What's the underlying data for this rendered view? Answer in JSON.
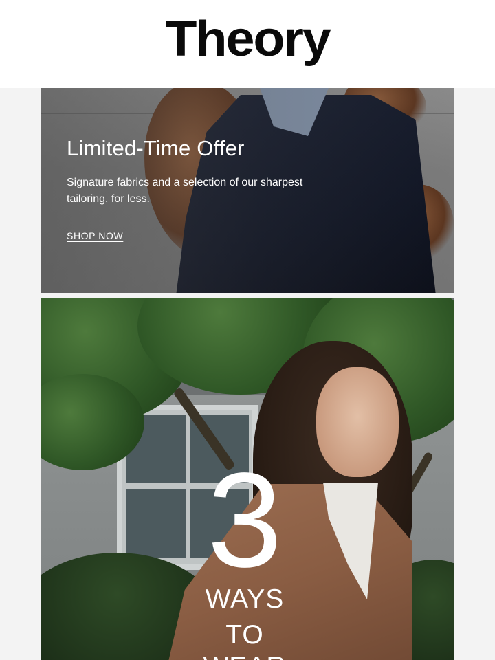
{
  "brand": {
    "logo_text": "Theory"
  },
  "promo": {
    "title": "Limited-Time Offer",
    "description": "Signature fabrics and a selection of our sharpest tailoring, for less.",
    "cta_label": "SHOP NOW"
  },
  "feature": {
    "number": "3",
    "line1": "WAYS",
    "line2": "TO",
    "line3": "WEAR"
  },
  "colors": {
    "page_background": "#f3f3f3",
    "header_background": "#ffffff",
    "text_on_image": "#ffffff",
    "logo": "#0a0a0a"
  }
}
